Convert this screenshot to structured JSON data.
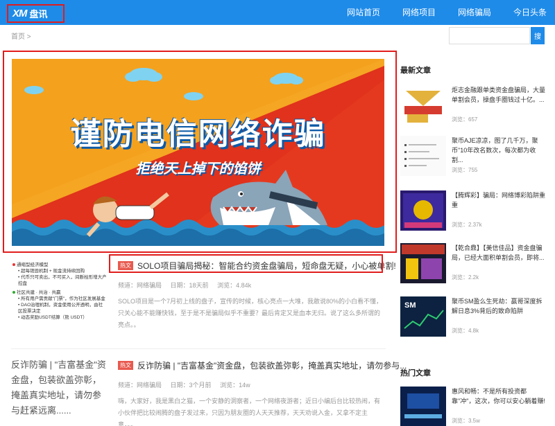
{
  "header": {
    "logo_mark": "XM",
    "logo_text": "盘讯",
    "nav": [
      "网站首页",
      "网络项目",
      "网络骗局",
      "今日头条"
    ]
  },
  "breadcrumb": "首页 >",
  "search": {
    "placeholder": "",
    "button": "搜"
  },
  "banner": {
    "title": "谨防电信网络诈骗",
    "subtitle": "拒绝天上掉下的馅饼",
    "shark_tag": "BUSINESS SHARK"
  },
  "articles": [
    {
      "tag": "热文",
      "title": "SOLO项目骗局揭秘：智能合约资金盘骗局，短命盘无疑，小心被单割!",
      "category": "频道：网络骗局",
      "date": "日期：18天前",
      "views": "浏览：4.84k",
      "excerpt": "SOLO项目是一个7月初上线的盘子，宣传的时候，核心亮点一大堆，我敢说80%的小白看不懂，只关心能不能赚快钱，至于是不是骗局似乎不重要？最后肯定又是血本无归。说了这么多所谓的亮点。。",
      "thumb_lines": [
        "通缩型经济模型",
        "超每销毁机制 + 现金流持续回购",
        "代币只可卖出，不可买入，间断柱形增大产控盘",
        "社区共建 · 共治 · 共赢",
        "所有用户需贡献\"门票\"，作为社区发展基金",
        "DAO治理机制，资金使用公开透明，由社区投票决定",
        "动态奖励USDT结算（熊 USDT）"
      ]
    },
    {
      "tag": "热文",
      "title": "反诈防骗 | \"吉富基金\"资金盘，包装欲盖弥彰，掩盖真实地址，请勿参与...",
      "category": "频道：网络骗局",
      "date": "日期：3个月前",
      "views": "浏览：14w",
      "excerpt": "嗨，大家好，我是黑白之猫，一个安静的洞察者，一个网络夜游者；近日小编后台比较热闹，有小伙伴把比较闹腾的盘子发过来，只因为朋友圈的人天天推荐，天天劝说入金，又拿不定主意，。。",
      "thumb_alt": "反诈防骗 | \"吉富基金\"资金盘，包装欲盖弥彰，掩盖真实地址，请勿参与赶紧远离......"
    }
  ],
  "sidebar": {
    "latest_heading": "最新文章",
    "latest": [
      {
        "title": "炬志金融跟单类资金盘骗局，大量单割会员，操盘手圈钱过十亿。...",
        "views": "浏览：657",
        "thumb_text": "金融骗局 火志"
      },
      {
        "title": "聚币AJE凉凉，图了几千万，聚币\"10年改名数次，每次都为收割...",
        "views": "浏览：755",
        "thumb_text": ""
      },
      {
        "title": "【腾辉彩】骗局：网络博彩陷阱重重",
        "views": "浏览：2.37k",
        "thumb_text": ""
      },
      {
        "title": "【乾合鼎】【美信佳品】资金盘骗局，已经大面积单割会员，即将...",
        "views": "浏览：2.2k",
        "thumb_text": ""
      },
      {
        "title": "聚币SM盈么生死劫：赢哥深度拆解日息3%背后的致命陷阱",
        "views": "浏览：4.8k",
        "thumb_text": "SM"
      }
    ],
    "hot_heading": "热门文章",
    "hot": [
      {
        "title": "惠风和畅：不是所有投资都靠\"冲\"，这次，你可以安心躺着赚!",
        "views": "浏览：3.5w"
      }
    ]
  },
  "colors": {
    "brand": "#1e8be9",
    "highlight": "#e11c1c",
    "tag": "#e85a4f"
  }
}
